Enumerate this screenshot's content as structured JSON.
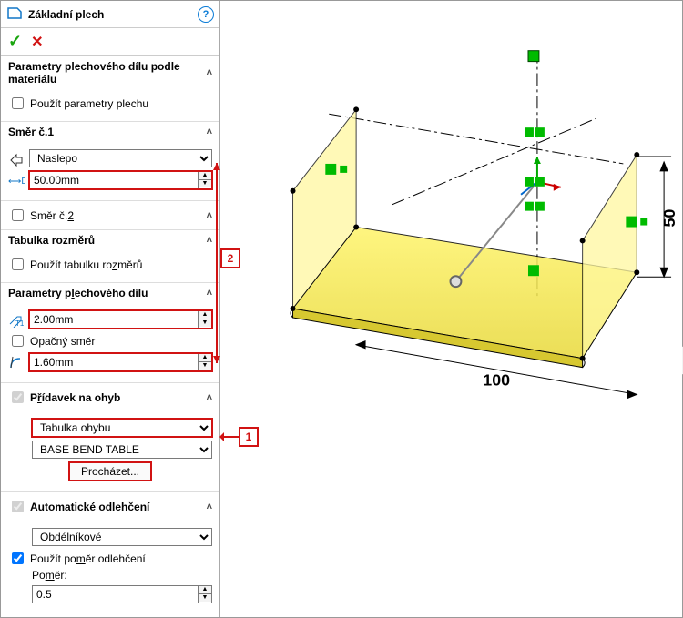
{
  "header": {
    "title": "Základní plech",
    "help": "?"
  },
  "confirm": {
    "ok": "✓",
    "cancel": "✕"
  },
  "sheet_params_mat": {
    "head": "Parametry plechového dílu podle materiálu",
    "use_sheet_params": "Použít parametry plechu"
  },
  "direction1": {
    "head_pre": "Směr č.",
    "head_u": "1",
    "type": "Naslepo",
    "depth": "50.00mm"
  },
  "direction2": {
    "pre": "Směr č.",
    "u": "2"
  },
  "gauge_table": {
    "head": "Tabulka rozměrů",
    "use_pre": "Použít tabulku ro",
    "use_u": "z",
    "use_post": "měrů"
  },
  "sheet_params": {
    "head_pre": "Parametry p",
    "head_u": "l",
    "head_post": "echového dílu",
    "thickness": "2.00mm",
    "reverse": "Opačný směr",
    "radius": "1.60mm"
  },
  "bend_allow": {
    "head_pre": "P",
    "head_u": "ř",
    "head_post": "ídavek na ohyb",
    "type": "Tabulka ohybu",
    "table": "BASE BEND TABLE",
    "browse": "Procházet..."
  },
  "relief": {
    "head_pre": "Auto",
    "head_u": "m",
    "head_post": "atické odlehčení",
    "type": "Obdélníkové",
    "use_ratio_pre": "Použít po",
    "use_ratio_u": "m",
    "use_ratio_post": "ěr odlehčení",
    "ratio_label_pre": "Po",
    "ratio_label_u": "m",
    "ratio_label_post": "ěr:",
    "ratio": "0.5"
  },
  "callouts": {
    "c1": "1",
    "c2": "2"
  },
  "model": {
    "dim_width": "100",
    "dim_height": "50"
  }
}
